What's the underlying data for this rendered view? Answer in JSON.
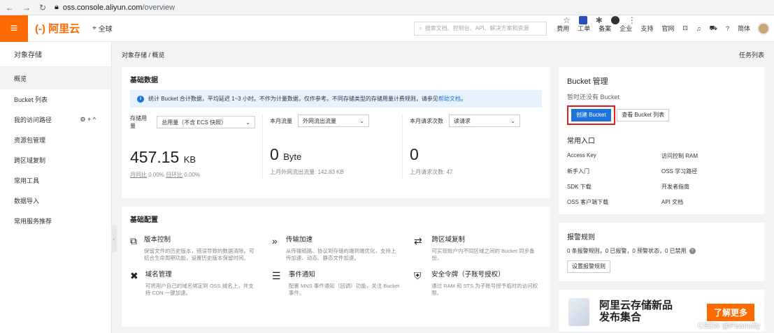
{
  "browser": {
    "url_host": "oss.console.aliyun.com",
    "url_path": "/overview"
  },
  "header": {
    "menu_icon": "≡",
    "logo": "(-) 阿里云",
    "region": "全球",
    "search_placeholder": "搜索文档、控制台、API、解决方案和资源",
    "nav": [
      "费用",
      "工单",
      "备案",
      "企业",
      "支持",
      "官网"
    ],
    "lang": "简体"
  },
  "sidebar": {
    "title": "对象存储",
    "items": [
      "概览",
      "Bucket 列表",
      "我的访问路径",
      "资源包管理",
      "跨区域复制",
      "常用工具",
      "数据导入",
      "常用服务推荐"
    ],
    "path_actions": "⚙ + ^"
  },
  "breadcrumb": {
    "text": "对象存储 / 概览",
    "tasks": "任务列表"
  },
  "basic_data": {
    "title": "基础数据",
    "notice_pre": "统计 Bucket 合计数据，平均延迟 1~3 小时。不作为计量数据，仅作参考。不同存储类型的存储用量计费规则，请参见",
    "notice_link": "帮助文档",
    "notice_post": "。",
    "storage": {
      "label": "存储用量",
      "select": "总用量（不含 ECS 快照）",
      "value": "457.15",
      "unit": "KB",
      "sub1": "月同比",
      "sub1v": " 0.00% ",
      "sub2": "日环比",
      "sub2v": " 0.00%"
    },
    "traffic": {
      "label": "本月流量",
      "select": "外网流出流量",
      "value": "0",
      "unit": "Byte",
      "sub": "上月外网流出流量: 142.83 KB"
    },
    "requests": {
      "label": "本月请求次数",
      "select": "读请求",
      "value": "0",
      "sub": "上月请求次数:  47"
    }
  },
  "basic_config": {
    "title": "基础配置",
    "features": [
      {
        "icon": "⧉",
        "title": "版本控制",
        "desc": "保留文件的历史版本，错误导致的数据清除。可结合生命周期功能，设置历史版本保留时间。"
      },
      {
        "icon": "»",
        "title": "传输加速",
        "desc": "从传输链路、协议到存储的端到端优化，支持上传加速、动态、静态文件加速。"
      },
      {
        "icon": "⇄",
        "title": "跨区域复制",
        "desc": "可实现账户内不同区域之间的 Bucket 同步备份。"
      },
      {
        "icon": "✖",
        "title": "域名管理",
        "desc": "可将用户自己的域名绑定到 OSS 域名上，并支持 CDN 一键加速。"
      },
      {
        "icon": "☰",
        "title": "事件通知",
        "desc": "配置 MNS 事件通知（回调）功能，关注 Bucket 事件。"
      },
      {
        "icon": "⛨",
        "title": "安全令牌（子账号授权）",
        "desc": "通过 RAM 和 STS 为子账号授予临时的访问权限。"
      }
    ]
  },
  "bucket_mgmt": {
    "title": "Bucket 管理",
    "empty": "暂时还没有 Bucket",
    "create": "创建 Bucket",
    "view": "查看 Bucket 列表"
  },
  "entry": {
    "title": "常用入口",
    "links": [
      "Access Key",
      "访问控制 RAM",
      "新手入门",
      "OSS 学习路径",
      "SDK 下载",
      "开发者指南",
      "OSS 客户端下载",
      "API 文档"
    ]
  },
  "alarm": {
    "title": "报警规则",
    "status": "0 条报警规则，0 已报警，0 预警状态，0 已禁用",
    "button": "设置报警规则"
  },
  "promo": {
    "line1": "阿里云存储新品",
    "line2": "发布集合",
    "cta": "了解更多",
    "watermark": "CSDN @Peanutty"
  }
}
